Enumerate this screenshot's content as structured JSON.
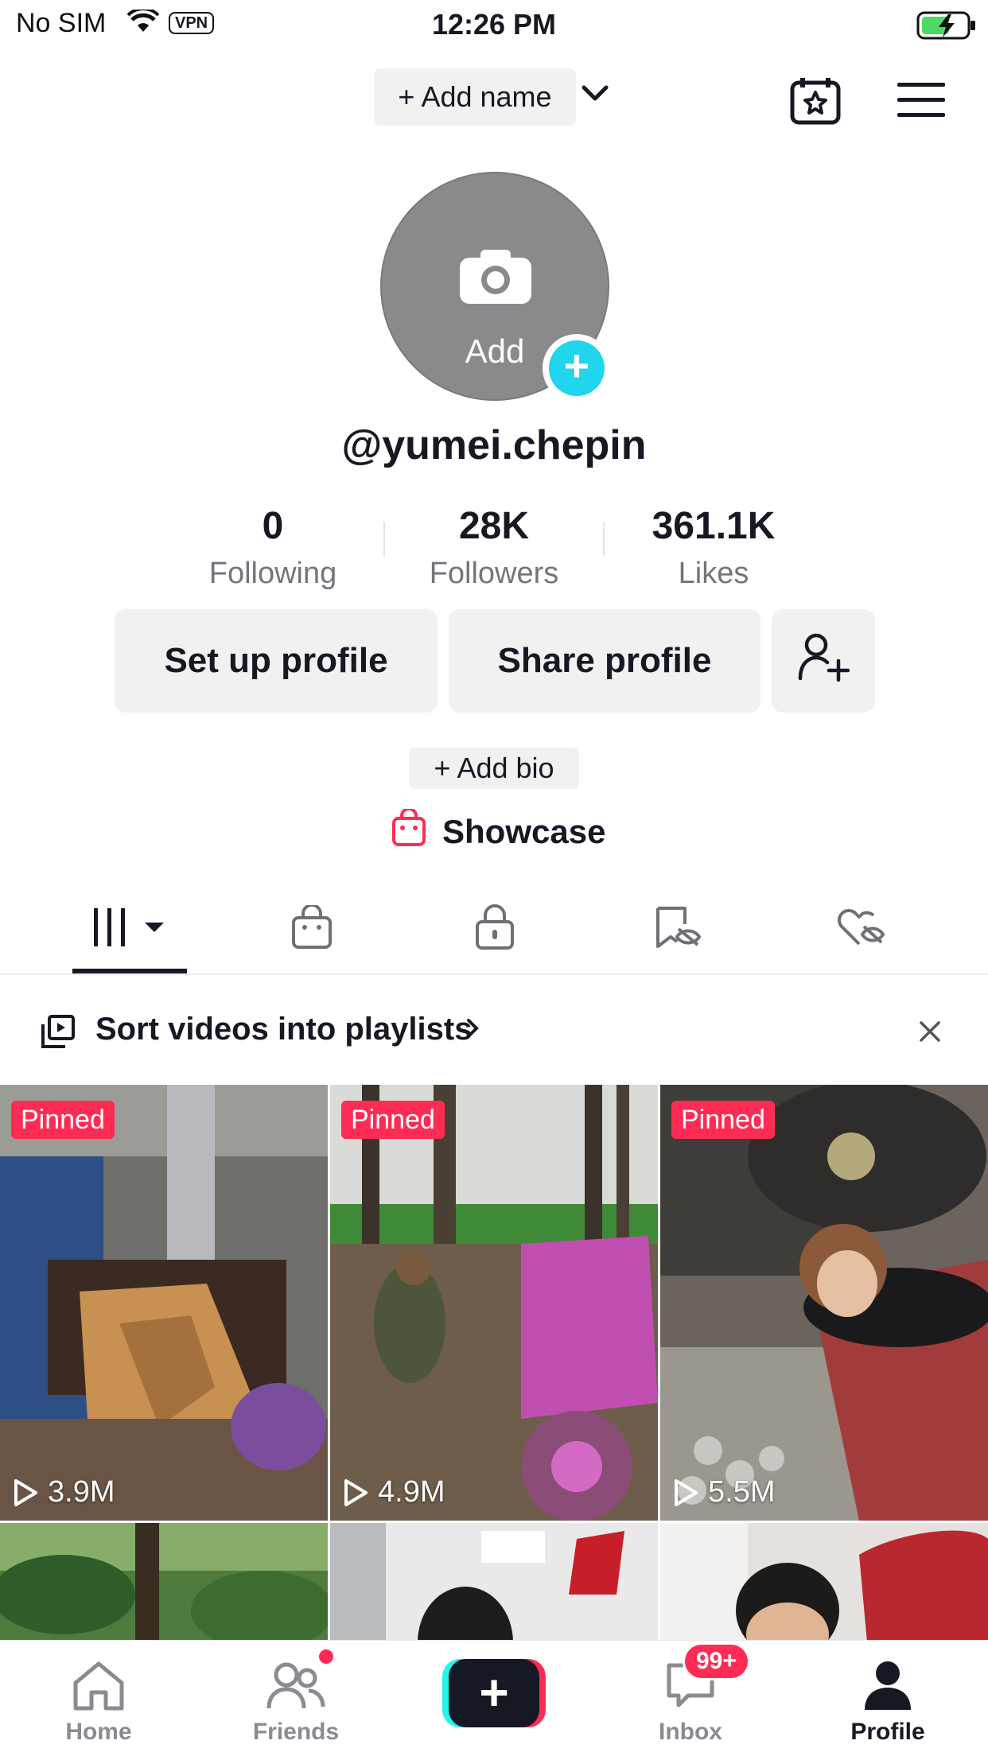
{
  "status_bar": {
    "carrier": "No SIM",
    "vpn": "VPN",
    "time": "12:26 PM"
  },
  "header": {
    "add_name": "+ Add name"
  },
  "avatar": {
    "add_label": "Add"
  },
  "profile": {
    "username": "@yumei.chepin",
    "add_bio": "+ Add bio",
    "showcase": "Showcase"
  },
  "stats": [
    {
      "value": "0",
      "label": "Following"
    },
    {
      "value": "28K",
      "label": "Followers"
    },
    {
      "value": "361.1K",
      "label": "Likes"
    }
  ],
  "buttons": {
    "setup": "Set up profile",
    "share": "Share profile"
  },
  "playlist_banner": {
    "text": "Sort videos into playlists"
  },
  "videos": [
    {
      "pinned": "Pinned",
      "views": "3.9M"
    },
    {
      "pinned": "Pinned",
      "views": "4.9M"
    },
    {
      "pinned": "Pinned",
      "views": "5.5M"
    }
  ],
  "nav": {
    "home": "Home",
    "friends": "Friends",
    "inbox": "Inbox",
    "inbox_badge": "99+",
    "profile": "Profile"
  },
  "colors": {
    "accent_red": "#fe2c55",
    "accent_cyan": "#20d5ec"
  }
}
